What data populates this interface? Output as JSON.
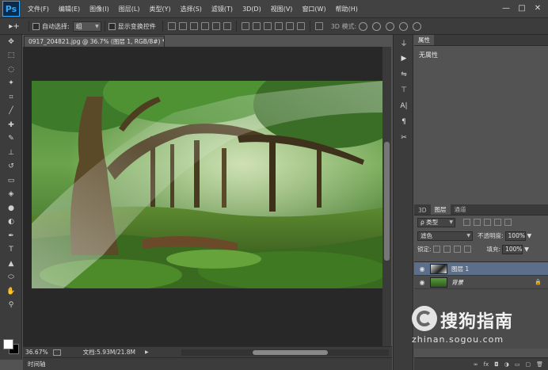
{
  "app": {
    "logo": "Ps",
    "menus": [
      "文件(F)",
      "编辑(E)",
      "图像(I)",
      "图层(L)",
      "类型(Y)",
      "选择(S)",
      "滤镜(T)",
      "3D(D)",
      "视图(V)",
      "窗口(W)",
      "帮助(H)"
    ],
    "window_controls": [
      "—",
      "□",
      "✕"
    ]
  },
  "options": {
    "auto_select_label": "自动选择:",
    "auto_select_value": "组",
    "show_transform_label": "显示变换控件",
    "mode3d_label": "3D 模式:"
  },
  "document": {
    "tab_title": "0917_204821.jpg @ 36.7% (图层 1, RGB/8#) *",
    "tab_close": "✕"
  },
  "status": {
    "zoom": "36.67%",
    "doc_info": "文档:5.93M/21.8M"
  },
  "timeline": {
    "label": "时间轴"
  },
  "properties": {
    "tab": "属性",
    "content": "无属性"
  },
  "layers": {
    "tabs": [
      "3D",
      "图层",
      "通道"
    ],
    "kind_filter": "ρ 类型",
    "blend_mode": "滤色",
    "opacity_label": "不透明度:",
    "opacity_value": "100%",
    "lock_label": "锁定:",
    "fill_label": "填充:",
    "fill_value": "100%",
    "items": [
      {
        "name": "图层 1",
        "visible": true,
        "selected": true
      },
      {
        "name": "背景",
        "visible": true,
        "selected": false,
        "locked": true
      }
    ],
    "footer_icons": [
      "link-icon",
      "fx-icon",
      "mask-icon",
      "adjustment-icon",
      "group-icon",
      "new-layer-icon",
      "trash-icon"
    ]
  },
  "watermark": {
    "title": "搜狗指南",
    "url": "zhinan.sogou.com"
  },
  "colors": {
    "foreground": "#ffffff",
    "background": "#000000",
    "accent": "#31a8ff"
  }
}
